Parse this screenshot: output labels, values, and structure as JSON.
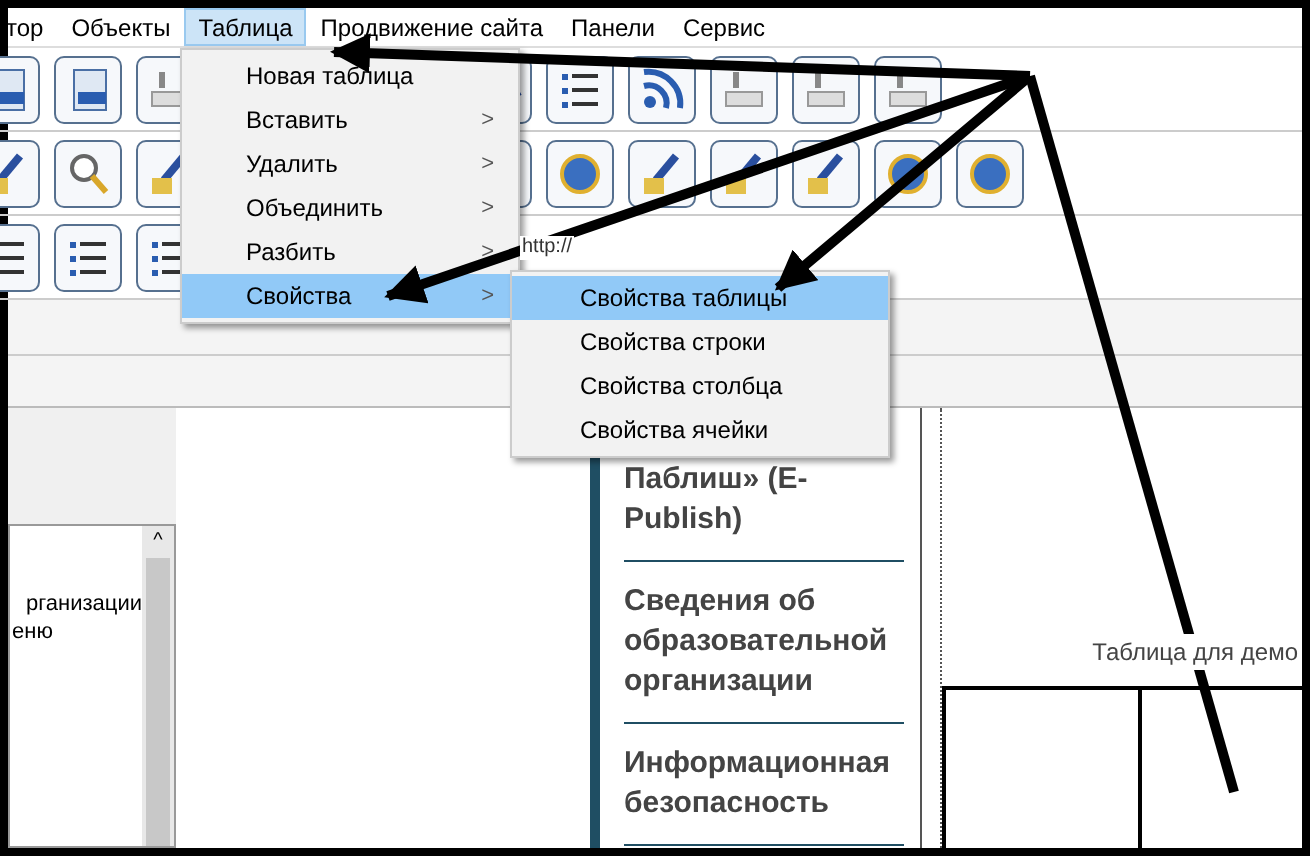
{
  "menu_bar": [
    {
      "label": "тор",
      "selected": false
    },
    {
      "label": "Объекты",
      "selected": false
    },
    {
      "label": "Таблица",
      "selected": true
    },
    {
      "label": "Продвижение сайта",
      "selected": false
    },
    {
      "label": "Панели",
      "selected": false
    },
    {
      "label": "Сервис",
      "selected": false
    }
  ],
  "open_menu": {
    "items": [
      {
        "label": "Новая таблица",
        "submenu": false,
        "selected": false
      },
      {
        "label": "Вставить",
        "submenu": true,
        "selected": false
      },
      {
        "label": "Удалить",
        "submenu": true,
        "selected": false
      },
      {
        "label": "Объединить",
        "submenu": true,
        "selected": false
      },
      {
        "label": "Разбить",
        "submenu": true,
        "selected": false
      },
      {
        "label": "Свойства",
        "submenu": true,
        "selected": true
      }
    ],
    "arrow": ">"
  },
  "submenu": {
    "items": [
      {
        "label": "Свойства таблицы",
        "selected": true
      },
      {
        "label": "Свойства строки",
        "selected": false
      },
      {
        "label": "Свойства столбца",
        "selected": false
      },
      {
        "label": "Свойства ячейки",
        "selected": false
      }
    ]
  },
  "toolbar": {
    "url_label": "http://"
  },
  "left_panel": {
    "lines": [
      "рганизации",
      "еню"
    ],
    "scroll_up": "^"
  },
  "page_nav": [
    "Паблиш» (E-Publish)",
    "Сведения об образовательной организации",
    "Информационная безопасность"
  ],
  "caption": "Таблица для демо"
}
